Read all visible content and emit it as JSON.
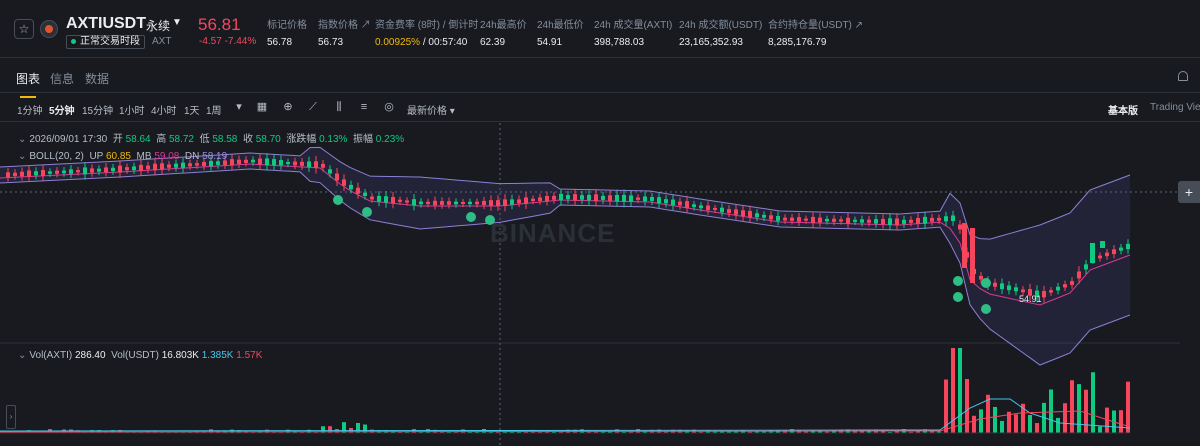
{
  "header": {
    "symbol": "AXTIUSDT",
    "contract_type": "永续",
    "status": "正常交易时段",
    "base_asset": "AXT",
    "last_price": "56.81",
    "change": "-4.57 -7.44%",
    "stats": [
      {
        "label": "标记价格",
        "value": "56.78"
      },
      {
        "label": "指数价格 ↗",
        "value": "56.73"
      },
      {
        "label": "资金费率 (8时) / 倒计时",
        "value_rate": "0.00925%",
        "value_countdown": "/ 00:57:40"
      },
      {
        "label": "24h最高价",
        "value": "62.39"
      },
      {
        "label": "24h最低价",
        "value": "54.91"
      },
      {
        "label": "24h 成交量(AXTI)",
        "value": "398,788.03"
      },
      {
        "label": "24h 成交额(USDT)",
        "value": "23,165,352.93"
      },
      {
        "label": "合约持仓量(USDT) ↗",
        "value": "8,285,176.79"
      }
    ]
  },
  "tabs": [
    "图表",
    "信息",
    "数据"
  ],
  "toolbar": {
    "timeframes": [
      "1分钟",
      "5分钟",
      "15分钟",
      "1小时",
      "4小时",
      "1天",
      "1周"
    ],
    "active_timeframe": "5分钟",
    "latest_price_label": "最新价格",
    "basic_label": "基本版",
    "tradingview_label": "Trading View"
  },
  "legend": {
    "date": "2026/09/01 17:30",
    "open_label": "开",
    "open": "58.64",
    "high_label": "高",
    "high": "58.72",
    "low_label": "低",
    "low": "58.58",
    "close_label": "收",
    "close": "58.70",
    "chg_label": "涨跌幅",
    "chg": "0.13%",
    "amp_label": "振幅",
    "amp": "0.23%",
    "boll_label": "BOLL(20, 2)",
    "boll_up_label": "UP",
    "boll_up": "60.85",
    "boll_mb_label": "MB",
    "boll_mb": "59.08",
    "boll_dn_label": "DN",
    "boll_dn": "58.19",
    "vol_label": "Vol(AXTI)",
    "vol": "286.40",
    "vol_usdt_label": "Vol(USDT)",
    "vol_usdt": "16.803K",
    "vol_ma1": "1.385K",
    "vol_ma2": "1.57K"
  },
  "chart_data": {
    "type": "candlestick",
    "min_price_label": "54.91",
    "watermark": "BINANCE",
    "colors": {
      "up": "#0ecb81",
      "down": "#f6465d",
      "boll_band": "#8e7fd6",
      "boll_mid": "#d63a98",
      "vol_ma1": "#45c7e8",
      "vol_ma2": "#f6465d"
    }
  }
}
